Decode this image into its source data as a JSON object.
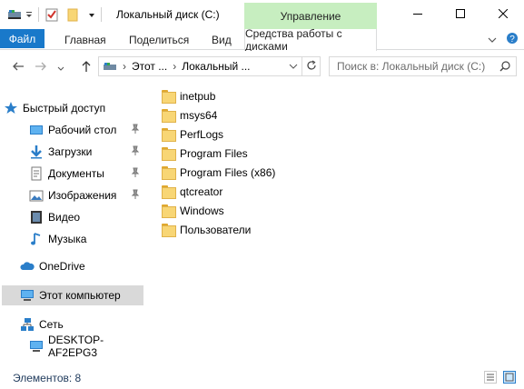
{
  "window": {
    "title": "Локальный диск (C:)",
    "context_tab": "Управление",
    "minimize_icon": "minimize-icon",
    "maximize_icon": "maximize-icon",
    "close_icon": "close-icon"
  },
  "ribbon": {
    "tabs": [
      {
        "label": "Файл"
      },
      {
        "label": "Главная"
      },
      {
        "label": "Поделиться"
      },
      {
        "label": "Вид"
      },
      {
        "label": "Средства работы с дисками"
      }
    ]
  },
  "address": {
    "crumb1": "Этот ...",
    "crumb2": "Локальный ...",
    "search_placeholder": "Поиск в: Локальный диск (C:)"
  },
  "navpane": {
    "items": [
      {
        "label": "Быстрый доступ",
        "icon": "star-icon"
      },
      {
        "label": "Рабочий стол",
        "icon": "desktop-icon"
      },
      {
        "label": "Загрузки",
        "icon": "download-icon"
      },
      {
        "label": "Документы",
        "icon": "documents-icon"
      },
      {
        "label": "Изображения",
        "icon": "pictures-icon"
      },
      {
        "label": "Видео",
        "icon": "video-icon"
      },
      {
        "label": "Музыка",
        "icon": "music-icon"
      },
      {
        "label": "OneDrive",
        "icon": "cloud-icon"
      },
      {
        "label": "Этот компьютер",
        "icon": "computer-icon"
      },
      {
        "label": "Сеть",
        "icon": "network-icon"
      },
      {
        "label": "DESKTOP-AF2EPG3",
        "icon": "computer-icon"
      }
    ]
  },
  "files": [
    {
      "name": "inetpub"
    },
    {
      "name": "msys64"
    },
    {
      "name": "PerfLogs"
    },
    {
      "name": "Program Files"
    },
    {
      "name": "Program Files (x86)"
    },
    {
      "name": "qtcreator"
    },
    {
      "name": "Windows"
    },
    {
      "name": "Пользователи"
    }
  ],
  "status": {
    "count": "Элементов: 8"
  },
  "colors": {
    "accent": "#1979ca",
    "context_tab": "#c7eec0",
    "selection": "#d9d9d9"
  }
}
